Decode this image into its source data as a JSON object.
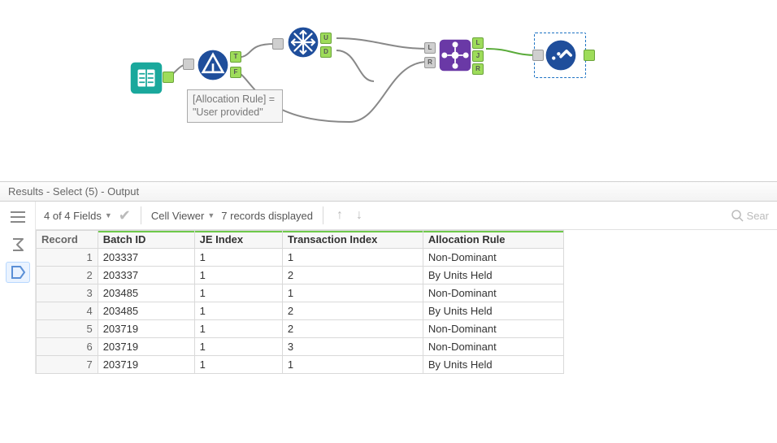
{
  "canvas": {
    "annotation": "[Allocation Rule] = \"User provided\"",
    "ports": {
      "filter_T": "T",
      "filter_F": "F",
      "unique_U": "U",
      "unique_D": "D",
      "join_L_in": "L",
      "join_R_in": "R",
      "join_L_out": "L",
      "join_J_out": "J",
      "join_R_out": "R"
    }
  },
  "results_title": "Results - Select (5) - Output",
  "toolbar": {
    "fields": "4 of 4 Fields",
    "cellviewer": "Cell Viewer",
    "records": "7 records displayed",
    "search_placeholder": "Sear"
  },
  "table": {
    "headers": [
      "Record",
      "Batch ID",
      "JE Index",
      "Transaction Index",
      "Allocation Rule"
    ],
    "rows": [
      {
        "rec": "1",
        "batch": "203337",
        "je": "1",
        "tx": "1",
        "rule": "Non-Dominant"
      },
      {
        "rec": "2",
        "batch": "203337",
        "je": "1",
        "tx": "2",
        "rule": "By Units Held"
      },
      {
        "rec": "3",
        "batch": "203485",
        "je": "1",
        "tx": "1",
        "rule": "Non-Dominant"
      },
      {
        "rec": "4",
        "batch": "203485",
        "je": "1",
        "tx": "2",
        "rule": "By Units Held"
      },
      {
        "rec": "5",
        "batch": "203719",
        "je": "1",
        "tx": "2",
        "rule": "Non-Dominant"
      },
      {
        "rec": "6",
        "batch": "203719",
        "je": "1",
        "tx": "3",
        "rule": "Non-Dominant"
      },
      {
        "rec": "7",
        "batch": "203719",
        "je": "1",
        "tx": "1",
        "rule": "By Units Held"
      }
    ]
  }
}
